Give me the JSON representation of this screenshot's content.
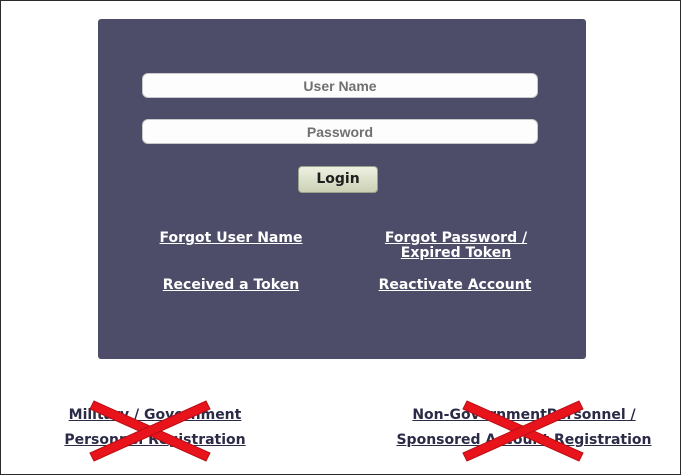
{
  "login": {
    "username_placeholder": "User Name",
    "password_placeholder": "Password",
    "login_button": "Login"
  },
  "links": {
    "forgot_username": "Forgot User Name",
    "forgot_password": "Forgot Password /",
    "forgot_password_line2": "Expired Token",
    "received_token": "Received a Token",
    "reactivate_account": "Reactivate Account"
  },
  "registration": {
    "military_line1": "Military / Government",
    "military_line2": "Personnel Registration",
    "nongov_line1": "Non-GovernmentPersonnel /",
    "nongov_line2": "Sponsored Account Registration"
  },
  "colors": {
    "panel": "#4d4d69",
    "cross_out": "#e8131b"
  }
}
